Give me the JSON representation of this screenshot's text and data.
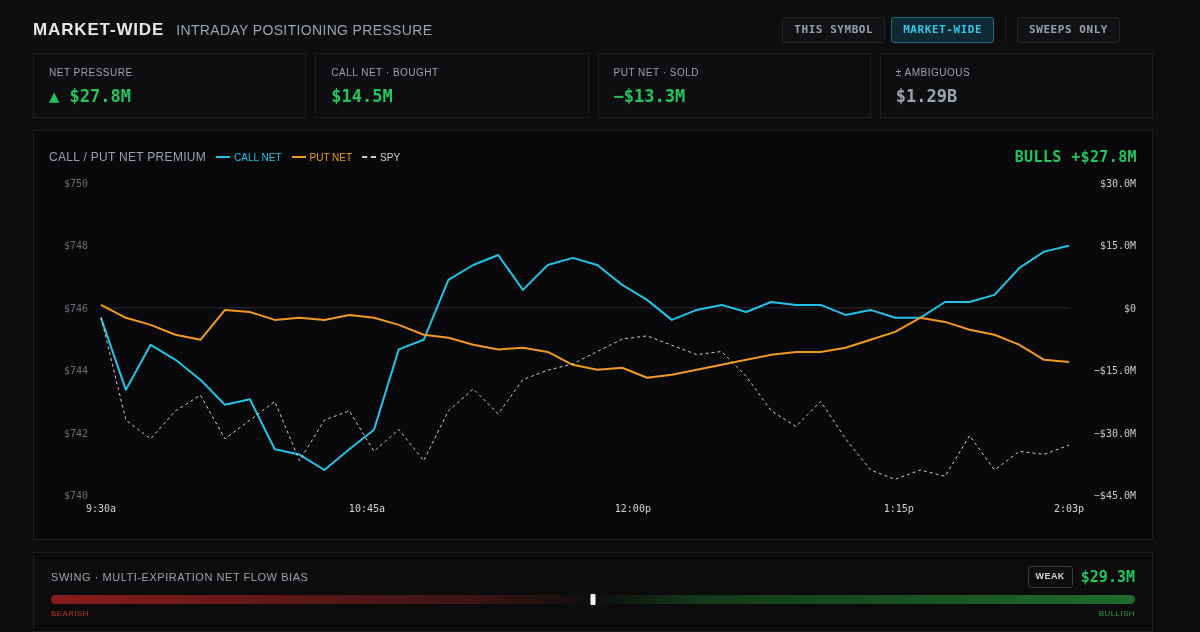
{
  "header": {
    "title": "MARKET-WIDE",
    "subtitle": "INTRADAY POSITIONING PRESSURE"
  },
  "scope_buttons": [
    {
      "label": "THIS SYMBOL",
      "selected": false
    },
    {
      "label": "MARKET-WIDE",
      "selected": true
    }
  ],
  "filter_buttons": [
    {
      "label": "SWEEPS ONLY",
      "on": false
    }
  ],
  "stats": [
    {
      "label": "NET PRESSURE",
      "value": "▲ $27.8M",
      "color": "#22c55e"
    },
    {
      "label": "CALL NET · BOUGHT",
      "value": "$14.5M",
      "color": "#22c55e"
    },
    {
      "label": "PUT NET · SOLD",
      "value": "−$13.3M",
      "color": "#22c55e"
    },
    {
      "label": "± AMBIGUOUS",
      "value": "$1.29B",
      "color": "#9ca3af"
    }
  ],
  "premium_panel": {
    "title": "CALL / PUT NET PREMIUM",
    "verdict": "BULLS +$27.8M",
    "chart_data": {
      "type": "line",
      "x": [
        9.5,
        9.617,
        9.733,
        9.85,
        9.967,
        10.083,
        10.2,
        10.317,
        10.433,
        10.55,
        10.667,
        10.783,
        10.9,
        11.017,
        11.133,
        11.25,
        11.367,
        11.483,
        11.6,
        11.717,
        11.833,
        11.95,
        12.067,
        12.183,
        12.3,
        12.417,
        12.533,
        12.65,
        12.767,
        12.883,
        13,
        13.117,
        13.233,
        13.35,
        13.467,
        13.583,
        13.7,
        13.817,
        13.933,
        14.05
      ],
      "xlim": [
        9.5,
        14.05
      ],
      "xticks": [
        {
          "value": 9.5,
          "label": "9:30a"
        },
        {
          "value": 10.75,
          "label": "10:45a"
        },
        {
          "value": 12,
          "label": "12:00p"
        },
        {
          "value": 13.25,
          "label": "1:15p"
        },
        {
          "value": 14.05,
          "label": "2:03p"
        }
      ],
      "ylim": [
        740,
        750
      ],
      "yticks": [
        {
          "value": 750,
          "label": "$750"
        },
        {
          "value": 748,
          "label": "$748"
        },
        {
          "value": 746,
          "label": "$746"
        },
        {
          "value": 744,
          "label": "$744"
        },
        {
          "value": 742,
          "label": "$742"
        },
        {
          "value": 740,
          "label": "$740"
        }
      ],
      "y2lim": [
        -45,
        30
      ],
      "y2ticks": [
        {
          "value": 30,
          "label": "$30.0M"
        },
        {
          "value": 15,
          "label": "$15.0M"
        },
        {
          "value": 0,
          "label": "$0"
        },
        {
          "value": -15,
          "label": "−$15.0M"
        },
        {
          "value": -30,
          "label": "−$30.0M"
        },
        {
          "value": -45,
          "label": "−$45.0M"
        }
      ],
      "series": [
        {
          "name": "CALL NET",
          "color": "#22c3e6",
          "axis": "y2",
          "line_style": "solid",
          "values": [
            -2.4,
            -19.7,
            -8.9,
            -12.5,
            -17.3,
            -23.3,
            -22,
            -34,
            -35.3,
            -39,
            -34,
            -29.3,
            -10,
            -7.7,
            6.7,
            10.3,
            12.7,
            4.3,
            10.3,
            12,
            10.3,
            5.5,
            1.9,
            -2.9,
            -0.5,
            0.7,
            -1,
            1.4,
            0.7,
            0.7,
            -1.7,
            -0.5,
            -2.4,
            -2.4,
            1.4,
            1.4,
            3.1,
            9.6,
            13.5,
            14.9
          ]
        },
        {
          "name": "PUT NET",
          "color": "#f29a1f",
          "axis": "y2",
          "line_style": "solid",
          "values": [
            0.7,
            -2.4,
            -4.1,
            -6.5,
            -7.7,
            -0.5,
            -1,
            -2.9,
            -2.4,
            -2.9,
            -1.7,
            -2.4,
            -4.1,
            -6.5,
            -7.2,
            -8.9,
            -10,
            -9.6,
            -10.6,
            -13.7,
            -14.9,
            -14.4,
            -16.8,
            -16.1,
            -14.9,
            -13.7,
            -12.5,
            -11.3,
            -10.6,
            -10.6,
            -9.6,
            -7.7,
            -5.8,
            -2.4,
            -3.4,
            -5.3,
            -6.5,
            -8.9,
            -12.5,
            -13
          ]
        },
        {
          "name": "SPY",
          "color": "#cccccc",
          "line_style": "dashed",
          "values": [
            745.7,
            742.4,
            741.8,
            742.7,
            743.2,
            741.8,
            742.4,
            743,
            741.1,
            742.4,
            742.7,
            741.4,
            742.1,
            741.1,
            742.7,
            743.4,
            742.6,
            743.7,
            744,
            744.2,
            744.6,
            745,
            745.1,
            744.8,
            744.5,
            744.6,
            743.8,
            742.7,
            742.2,
            743,
            741.8,
            740.8,
            740.5,
            740.8,
            740.6,
            741.9,
            740.8,
            741.4,
            741.3,
            741.6
          ]
        }
      ]
    }
  },
  "bias_panel": {
    "title": "SWING · MULTI-EXPIRATION NET FLOW BIAS",
    "strength": "WEAK",
    "value": "$29.3M",
    "level": 0.5,
    "low_label": "BEARISH",
    "high_label": "BULLISH"
  }
}
